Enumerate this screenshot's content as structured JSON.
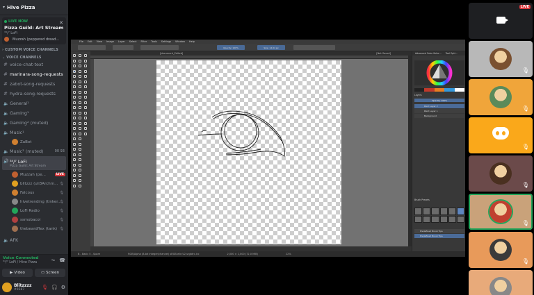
{
  "server": {
    "name": "Hive Pizza"
  },
  "live": {
    "tag": "LIVE NOW",
    "title": "Pizza Guild: Art Stream",
    "channel": "³⁴/⁷ LoFi",
    "streamer": "Muzzah (peppered dread..."
  },
  "categories": {
    "custom": "CUSTOM VOICE CHANNELS",
    "voice": "VOICE CHANNELS"
  },
  "channels": {
    "voice_chat_text": "voice-chat-text",
    "marinara": "marinara-song-requests",
    "zabot": "zabot-song-requests",
    "hydra": "hydra-song-requests",
    "general": "General¹",
    "gaming1": "Gaming¹",
    "gaming2": "Gaming² (muted)",
    "music1": "Music¹",
    "music1_user": "ZaBot",
    "music2": "Music² (muted)",
    "music2_count": "00  93",
    "lofi": "³⁴/⁷ LoFi",
    "lofi_sub": "Pizza Guild: Art Stream",
    "afk": "AFK"
  },
  "lofi_users": [
    {
      "name": "Muzzah (pe...",
      "badge": "LIVE",
      "color": "#c06030"
    },
    {
      "name": "blitzzz (uli3Archm...",
      "color": "#e0a020"
    },
    {
      "name": "Falcous",
      "color": "#d08030"
    },
    {
      "name": "hivetrending (tinker...",
      "color": "#888888"
    },
    {
      "name": "LoFi Radio",
      "color": "#23a55a"
    },
    {
      "name": "ssmobacoi",
      "color": "#b04040"
    },
    {
      "name": "thebeardflex (tank)",
      "color": "#a07050"
    }
  ],
  "voice_panel": {
    "status": "Voice Connected",
    "channel": "³⁴/⁷ LoFi / Hive Pizza",
    "video_label": "Video",
    "screen_label": "Screen"
  },
  "user": {
    "name": "Blitzzzz",
    "tag": "#9287"
  },
  "krita": {
    "menu": [
      "File",
      "Edit",
      "View",
      "Image",
      "Layer",
      "Select",
      "Filter",
      "Tools",
      "Settings",
      "Window",
      "Help"
    ],
    "doc_tab": "[document_Edited]",
    "doc_tab2": "[Not Saved]",
    "opacity_label": "Opacity: 100%",
    "size_label": "Size: 12.04 px",
    "status_left": "B - Basic 5 - Spare",
    "status_mid": "RGB/Alpha (8-bit integer/channel)  sRGB-elle-V2-srgbtrc.icc",
    "status_right": "2,000 × 2,000 (72.0 MiB)",
    "zoom": "22%",
    "dock_tabs": [
      "Advanced Color Selec...",
      "Tool Opti..."
    ],
    "layers_tab": "Layers",
    "layers": [
      "Paint Layer 2",
      "Paint Layer 1",
      "Background"
    ],
    "brush_tab": "Brush Presets",
    "brush_rows": [
      "Predefined Brush Tips",
      "Predefined Brush Tips"
    ]
  },
  "tiles": [
    {
      "kind": "stream",
      "badge": "LIVE",
      "bg": "#1e1f22"
    },
    {
      "kind": "avatar",
      "bg": "#b8b8b8"
    },
    {
      "kind": "avatar",
      "bg": "#f0a53a"
    },
    {
      "kind": "discord",
      "bg": "#faa81a"
    },
    {
      "kind": "avatar",
      "bg": "#6b4a4a"
    },
    {
      "kind": "avatar",
      "bg": "#c9a27a"
    },
    {
      "kind": "avatar",
      "bg": "#e89a5a"
    },
    {
      "kind": "avatar",
      "bg": "#e8aa7a"
    }
  ]
}
